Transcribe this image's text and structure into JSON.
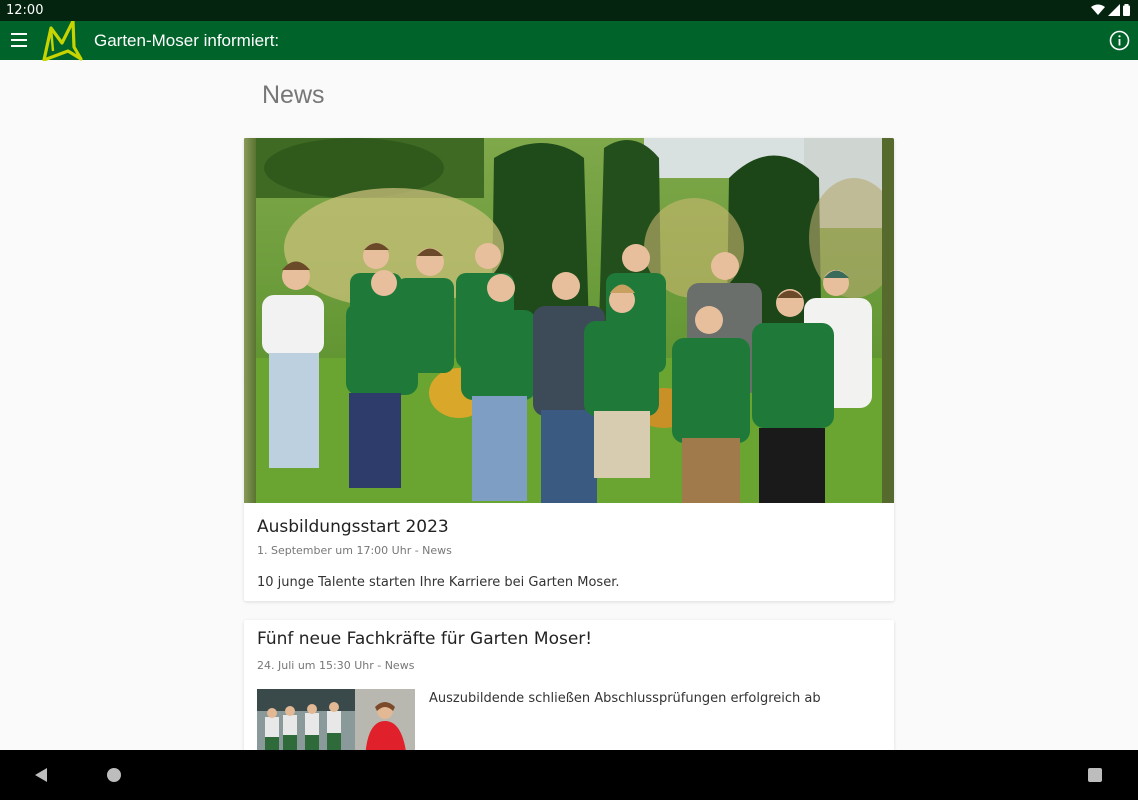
{
  "status_bar": {
    "time": "12:00",
    "icons": [
      "wifi-icon",
      "signal-icon",
      "battery-icon"
    ]
  },
  "app_bar": {
    "title": "Garten-Moser informiert:",
    "menu_icon": "menu-icon",
    "info_icon": "info-icon"
  },
  "page": {
    "heading": "News"
  },
  "news": [
    {
      "title": "Ausbildungsstart 2023",
      "meta": "1. September um 17:00 Uhr - News",
      "text": "10 junge Talente starten Ihre Karriere bei Garten Moser."
    },
    {
      "title": "Fünf neue Fachkräfte für Garten Moser!",
      "meta": "24. Juli um 15:30 Uhr - News",
      "text": "Auszubildende schließen Abschlussprüfungen erfolgreich ab"
    }
  ],
  "colors": {
    "app_bar": "#00632a",
    "status_bar": "#04240f",
    "accent_yellow": "#c8d400"
  },
  "nav_bar": {
    "icons": [
      "back-icon",
      "home-icon",
      "recent-apps-icon"
    ]
  }
}
